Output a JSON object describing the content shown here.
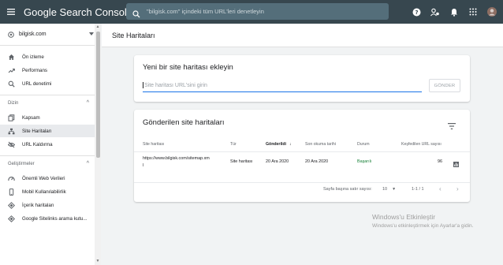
{
  "app": {
    "title_google": "Google",
    "title_product": "Search Console",
    "search_placeholder": "\"bilgisk.com\" içindeki tüm URL'leri denetleyin"
  },
  "sidebar": {
    "property": "bilgisk.com",
    "items_top": [
      {
        "label": "Ön izleme",
        "icon": "home-icon"
      },
      {
        "label": "Performans",
        "icon": "trending-icon"
      },
      {
        "label": "URL denetimi",
        "icon": "search-icon"
      }
    ],
    "section_index": "Dizin",
    "items_index": [
      {
        "label": "Kapsam",
        "icon": "copy-icon"
      },
      {
        "label": "Site Haritaları",
        "icon": "sitemap-icon",
        "active": true
      },
      {
        "label": "URL Kaldırma",
        "icon": "eye-off-icon"
      }
    ],
    "section_enh": "Geliştirmeler",
    "items_enh": [
      {
        "label": "Önemli Web Verileri",
        "icon": "gauge-icon"
      },
      {
        "label": "Mobil Kullanılabilirlik",
        "icon": "phone-icon"
      },
      {
        "label": "İçerik haritaları",
        "icon": "layers-icon"
      },
      {
        "label": "Google Sitelinks arama kutu...",
        "icon": "layers-icon"
      }
    ]
  },
  "page": {
    "title": "Site Haritaları"
  },
  "add_card": {
    "title": "Yeni bir site haritası ekleyin",
    "input_placeholder": "Site haritası URL'sini girin",
    "submit_label": "GÖNDER"
  },
  "submitted_card": {
    "title": "Gönderilen site haritaları",
    "columns": [
      "Site haritası",
      "Tür",
      "Gönderildi",
      "Son okuma tarihi",
      "Durum",
      "Keşfedilen URL sayısı"
    ],
    "rows": [
      {
        "url_line1": "https://www.bilgisk.com/sitemap.xm",
        "url_line2": "l",
        "type": "Site haritası",
        "submitted": "20 Ara 2020",
        "last_read": "20 Ara 2020",
        "status": "Başarılı",
        "discovered": "96"
      }
    ],
    "rows_per_page_label": "Sayfa başına satır sayısı:",
    "rows_per_page": "10",
    "range": "1-1 / 1"
  },
  "watermark": {
    "line1": "Windows'u Etkinleştir",
    "line2": "Windows'u etkinleştirmek için Ayarlar'a gidin."
  },
  "colors": {
    "topbar": "#37474f",
    "accent": "#1a73e8",
    "success": "#188038"
  }
}
